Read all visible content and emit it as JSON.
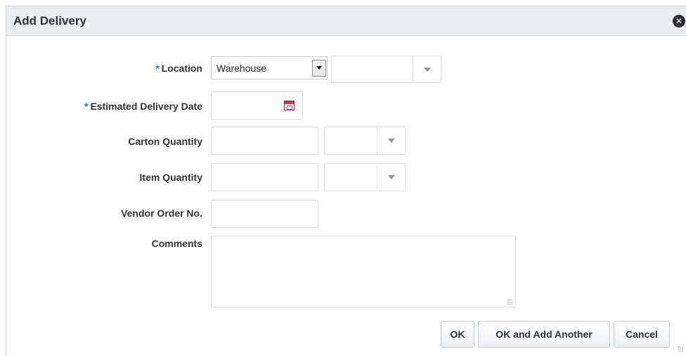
{
  "dialog": {
    "title": "Add Delivery"
  },
  "form": {
    "required_marker": "*",
    "location": {
      "label": "Location",
      "type_value": "Warehouse",
      "location_value": ""
    },
    "estimated_delivery_date": {
      "label": "Estimated Delivery Date",
      "value": ""
    },
    "carton_quantity": {
      "label": "Carton Quantity",
      "value": "",
      "uom": ""
    },
    "item_quantity": {
      "label": "Item Quantity",
      "value": "",
      "uom": ""
    },
    "vendor_order_no": {
      "label": "Vendor Order No.",
      "value": ""
    },
    "comments": {
      "label": "Comments",
      "value": ""
    }
  },
  "buttons": {
    "ok": "OK",
    "ok_add_another": "OK and Add Another",
    "cancel": "Cancel"
  },
  "icons": {
    "close": "close-icon",
    "calendar": "calendar-icon",
    "dropdown": "chevron-down-icon"
  },
  "colors": {
    "required": "#2a7ab8",
    "header_bg": "#ebeef0"
  }
}
